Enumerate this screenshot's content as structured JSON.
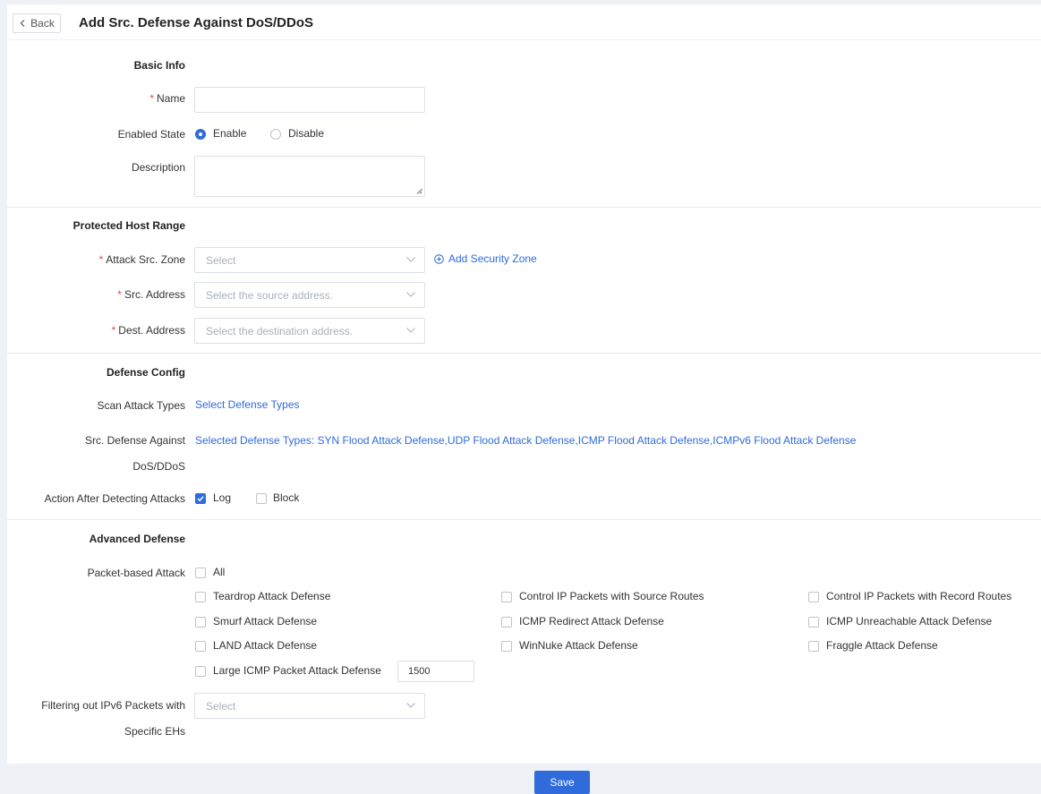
{
  "header": {
    "back_label": "Back",
    "title": "Add Src. Defense Against DoS/DDoS"
  },
  "basic_info": {
    "section_title": "Basic Info",
    "name_label": "Name",
    "name_value": "",
    "enabled_state_label": "Enabled State",
    "enable_label": "Enable",
    "disable_label": "Disable",
    "enabled": true,
    "description_label": "Description",
    "description_value": ""
  },
  "protected_host_range": {
    "section_title": "Protected Host Range",
    "attack_src_zone_label": "Attack Src. Zone",
    "attack_src_zone_placeholder": "Select",
    "add_security_zone_label": "Add Security Zone",
    "src_address_label": "Src. Address",
    "src_address_placeholder": "Select the source address.",
    "dest_address_label": "Dest. Address",
    "dest_address_placeholder": "Select the destination address."
  },
  "defense_config": {
    "section_title": "Defense Config",
    "scan_attack_types_label": "Scan Attack Types",
    "select_defense_types_link": "Select Defense Types",
    "src_defense_label_line1": "Src. Defense Against",
    "src_defense_label_line2": "DoS/DDoS",
    "selected_defense_types": "Selected Defense Types: SYN Flood Attack Defense,UDP Flood Attack Defense,ICMP Flood Attack Defense,ICMPv6 Flood Attack Defense",
    "action_label": "Action After Detecting Attacks",
    "log_label": "Log",
    "log_checked": true,
    "block_label": "Block",
    "block_checked": false
  },
  "advanced_defense": {
    "section_title": "Advanced Defense",
    "packet_based_label": "Packet-based Attack",
    "all_label": "All",
    "options": [
      "Teardrop Attack Defense",
      "Control IP Packets with Source Routes",
      "Control IP Packets with Record Routes",
      "Smurf Attack Defense",
      "ICMP Redirect Attack Defense",
      "ICMP Unreachable Attack Defense",
      "LAND Attack Defense",
      "WinNuke Attack Defense",
      "Fraggle Attack Defense",
      "Large ICMP Packet Attack Defense"
    ],
    "large_icmp_value": "1500",
    "ipv6_label_line1": "Filtering out IPv6 Packets with",
    "ipv6_label_line2": "Specific EHs",
    "ipv6_placeholder": "Select"
  },
  "footer": {
    "save_label": "Save"
  },
  "colors": {
    "accent": "#2f6bdb",
    "required": "#e5484d"
  }
}
